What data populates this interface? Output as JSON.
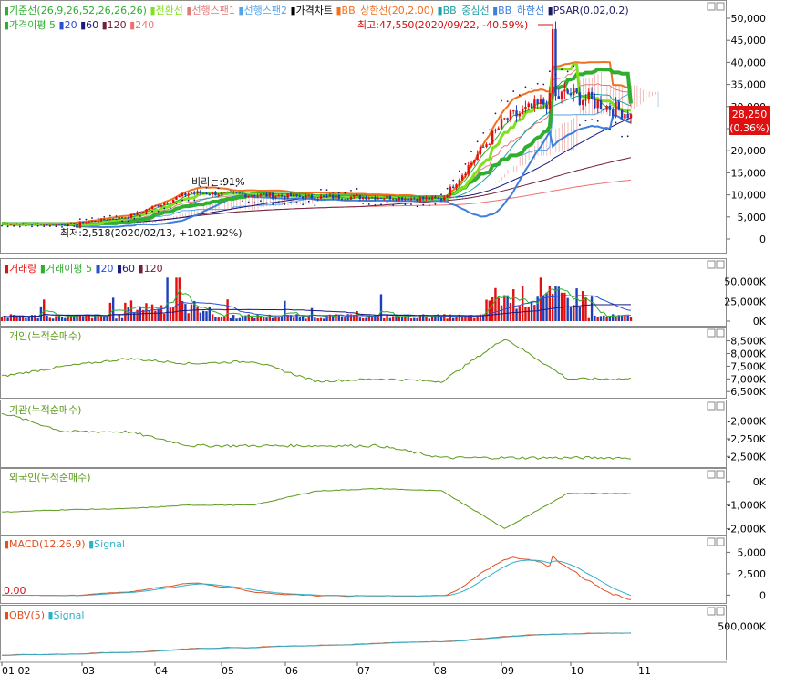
{
  "colors": {
    "rise": "#e01010",
    "fall": "#1f3fb8",
    "tenkan": "#80e020",
    "kijun": "#2fae2f",
    "span1": "#e27b78",
    "span2": "#56a3e6",
    "bbUpper": "#f07020",
    "bbMid": "#20a0a0",
    "bbLower": "#3f7fdc",
    "psar": "#1c1c64",
    "ma20": "#2a50d0",
    "ma60": "#1a1a80",
    "ma120": "#70203a",
    "ma240": "#f07070",
    "flow": "#5c9a1a",
    "macd": "#e05020",
    "signal": "#30b0c8",
    "current": "#e01010"
  },
  "price_legend_row1": [
    {
      "text": "기준선(26,9,26,52,26,26,26)",
      "color": "#2fae2f"
    },
    {
      "text": "전환선",
      "color": "#80e020"
    },
    {
      "text": "선행스팬1",
      "color": "#e27b78"
    },
    {
      "text": "선행스팬2",
      "color": "#56a3e6"
    },
    {
      "text": "가격차트",
      "color": "#000000"
    },
    {
      "text": "BB_상한선(20,2.00)",
      "color": "#f07020"
    },
    {
      "text": "BB_중심선",
      "color": "#20a0a0"
    },
    {
      "text": "BB_하한선",
      "color": "#3f7fdc"
    },
    {
      "text": "PSAR(0.02,0.2)",
      "color": "#1c1c64"
    }
  ],
  "price_legend_row2": [
    {
      "text": "가격이평 5",
      "color": "#2fae2f"
    },
    {
      "text": "20",
      "color": "#2a50d0"
    },
    {
      "text": "60",
      "color": "#1a1a80"
    },
    {
      "text": "120",
      "color": "#70203a"
    },
    {
      "text": "240",
      "color": "#f07070"
    }
  ],
  "volume_legend": [
    {
      "text": "거래량",
      "color": "#e01010"
    },
    {
      "text": "거래이평 5",
      "color": "#2fae2f"
    },
    {
      "text": "20",
      "color": "#2a50d0"
    },
    {
      "text": "60",
      "color": "#1a1a80"
    },
    {
      "text": "120",
      "color": "#70203a"
    }
  ],
  "individual_legend": "개인(누적순매수)",
  "institution_legend": "기관(누적순매수)",
  "foreign_legend": "외국인(누적순매수)",
  "macd_legend": [
    {
      "text": "MACD(12,26,9)",
      "color": "#e05020"
    },
    {
      "text": "Signal",
      "color": "#30b0c8"
    }
  ],
  "obv_legend": [
    {
      "text": "OBV(5)",
      "color": "#e05020"
    },
    {
      "text": "Signal",
      "color": "#30b0c8"
    }
  ],
  "high_annotation": "최고:47,550(2020/09/22, -40.59%)",
  "low_annotation": "최저:2,518(2020/02/13, +1021.92%)",
  "mid_annotation": "비리는:91%",
  "macd_zero_label": "0.00",
  "current_price": "28,250",
  "current_change": "(0.36%)",
  "x_axis_labels": [
    "01 02",
    "03",
    "04",
    "05",
    "06",
    "07",
    "08",
    "09",
    "10",
    "11"
  ],
  "price_ticks": [
    "50,000",
    "45,000",
    "40,000",
    "35,000",
    "30,000",
    "25,000",
    "20,000",
    "15,000",
    "10,000",
    "5,000",
    "0"
  ],
  "volume_ticks": [
    "50,000K",
    "25,000K",
    "0K"
  ],
  "individual_ticks": [
    "8,500K",
    "8,000K",
    "7,500K",
    "7,000K",
    "6,500K"
  ],
  "institution_ticks": [
    "-2,000K",
    "-2,250K",
    "-2,500K"
  ],
  "foreign_ticks": [
    "0K",
    "-1,000K",
    "-2,000K"
  ],
  "macd_ticks": [
    "5,000",
    "2,500",
    "0"
  ],
  "obv_ticks": [
    "500,000K"
  ],
  "chart_data": {
    "type": "line",
    "x_months": [
      "01",
      "02",
      "03",
      "04",
      "05",
      "06",
      "07",
      "08",
      "09",
      "10",
      "11"
    ],
    "price_panel": {
      "ylim": [
        0,
        52000
      ],
      "highest": {
        "value": 47550,
        "date": "2020/09/22",
        "change_pct": -40.59
      },
      "lowest": {
        "value": 2518,
        "date": "2020/02/13",
        "change_pct": 1021.92
      },
      "current": {
        "value": 28250,
        "change_pct": 0.36
      },
      "close_monthly_approx": [
        3500,
        3300,
        5000,
        10500,
        10000,
        9500,
        9500,
        9000,
        27000,
        33000,
        28250
      ]
    },
    "volume_panel": {
      "ylim_k": [
        0,
        60000
      ]
    },
    "individual_panel": {
      "ylim_k": [
        6400,
        8700
      ]
    },
    "institution_panel": {
      "ylim_k": [
        -2600,
        -1850
      ]
    },
    "foreign_panel": {
      "ylim_k": [
        -2100,
        150
      ]
    },
    "macd_panel": {
      "ylim": [
        -600,
        6000
      ]
    },
    "obv_panel": {
      "ylim_k": [
        0,
        700000
      ]
    }
  }
}
